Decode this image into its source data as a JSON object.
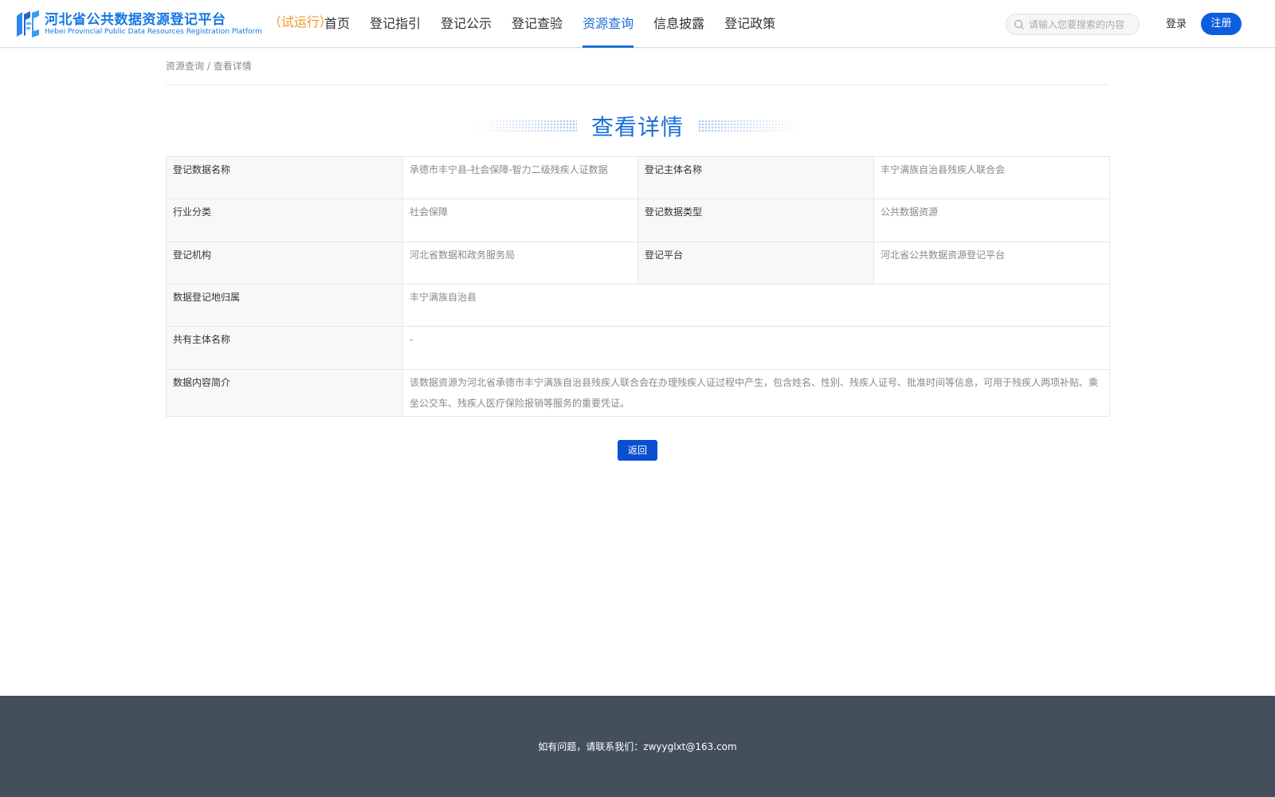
{
  "header": {
    "logo_cn": "河北省公共数据资源登记平台",
    "logo_en": "Hebei Provincial Public Data Resources Registration Platform",
    "logo_trial": "（试运行）",
    "nav": [
      {
        "label": "首页"
      },
      {
        "label": "登记指引"
      },
      {
        "label": "登记公示"
      },
      {
        "label": "登记查验"
      },
      {
        "label": "资源查询"
      },
      {
        "label": "信息披露"
      },
      {
        "label": "登记政策"
      }
    ],
    "active_nav": "资源查询",
    "search_placeholder": "请输入您要搜索的内容",
    "login_label": "登录",
    "register_label": "注册"
  },
  "breadcrumb": {
    "parent": "资源查询",
    "separator": " / ",
    "current": "查看详情"
  },
  "title": "查看详情",
  "details": {
    "rows": [
      {
        "l1": "登记数据名称",
        "v1": "承德市丰宁县-社会保障-智力二级残疾人证数据",
        "l2": "登记主体名称",
        "v2": "丰宁满族自治县残疾人联合会"
      },
      {
        "l1": "行业分类",
        "v1": "社会保障",
        "l2": "登记数据类型",
        "v2": "公共数据资源"
      },
      {
        "l1": "登记机构",
        "v1": "河北省数据和政务服务局",
        "l2": "登记平台",
        "v2": "河北省公共数据资源登记平台"
      }
    ],
    "attribution_label": "数据登记地归属",
    "attribution_value": "丰宁满族自治县",
    "co_owner_label": "共有主体名称",
    "co_owner_value": "-",
    "summary_label": "数据内容简介",
    "summary_value": "该数据资源为河北省承德市丰宁满族自治县残疾人联合会在办理残疾人证过程中产生，包含姓名、性别、残疾人证号、批准时间等信息，可用于残疾人两项补贴、乘坐公交车、残疾人医疗保险报销等服务的重要凭证。"
  },
  "back_label": "返回",
  "footer": {
    "contact": "如有问题，请联系我们：zwyyglxt@163.com"
  },
  "colors": {
    "brand_blue": "#1a6fd9",
    "button_blue": "#0b4fd1",
    "trial_orange": "#f0962b",
    "footer_bg": "#434f5b"
  }
}
